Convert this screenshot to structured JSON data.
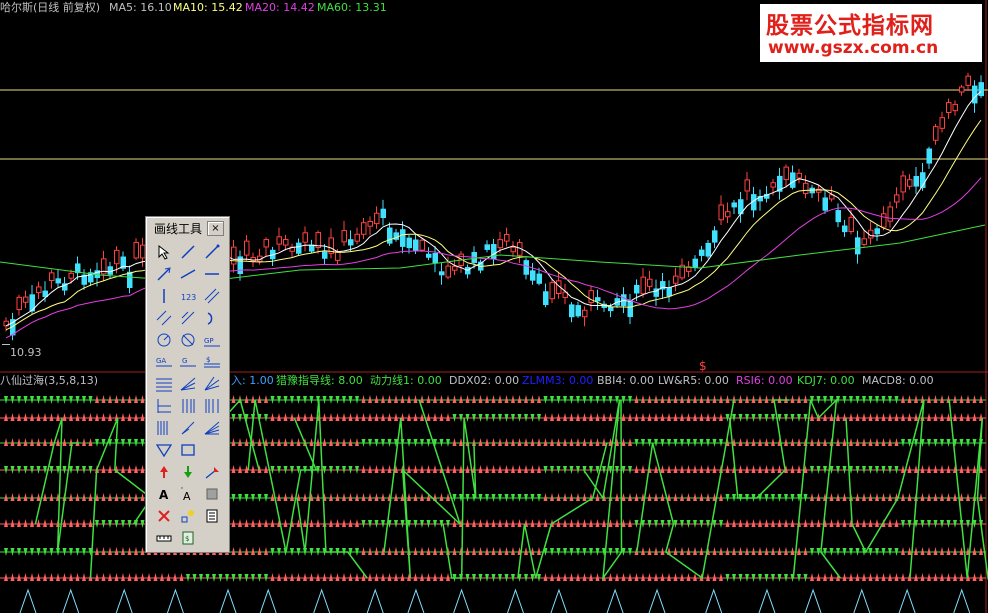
{
  "header": {
    "title": "哈尔斯(日线 前复权)",
    "ma5": "MA5: 16.10",
    "ma10": "MA10: 15.42",
    "ma20": "MA20: 14.42",
    "ma60": "MA60: 13.31"
  },
  "watermark": {
    "line1": "股票公式指标网",
    "line2": "www.gszx.com.cn"
  },
  "price_axis": {
    "low_label": "10.93"
  },
  "indicator": {
    "name": "八仙过海(3,5,8,13)",
    "items": [
      {
        "key": "i1",
        "text": "入: 1.00",
        "color": "#40a0ff"
      },
      {
        "key": "i2",
        "text": "猎豫指导线: 8.00",
        "color": "#40e040"
      },
      {
        "key": "i3",
        "text": "动力线1: 0.00",
        "color": "#40e040"
      },
      {
        "key": "i4",
        "text": "DDX02: 0.00",
        "color": "#c0c0c0"
      },
      {
        "key": "i5",
        "text": "ZLMM3: 0.00",
        "color": "#2020ff"
      },
      {
        "key": "i6",
        "text": "BBI4: 0.00",
        "color": "#c0c0c0"
      },
      {
        "key": "i7",
        "text": "LW&R5: 0.00",
        "color": "#c0c0c0"
      },
      {
        "key": "i8",
        "text": "RSI6: 0.00",
        "color": "#e040e0"
      },
      {
        "key": "i9",
        "text": "KDJ7: 0.00",
        "color": "#40e040"
      },
      {
        "key": "i10",
        "text": "MACD8: 0.00",
        "color": "#c0c0c0"
      }
    ]
  },
  "marker": "$",
  "toolbox": {
    "title": "画线工具",
    "close": "×",
    "tools": [
      "pointer-icon",
      "line-segment-icon",
      "ray-icon",
      "arrow-line-icon",
      "extended-line-icon",
      "horizontal-line-icon",
      "vertical-line-icon",
      "ruler-123-icon",
      "parallel-lines-icon",
      "channel-icon",
      "trend-channel-icon",
      "arc-icon",
      "circle-icon",
      "cycle-icon",
      "gann-point-icon",
      "gann-angle-icon",
      "gann-box-icon",
      "speed-lines-icon",
      "fibonacci-icon",
      "fan-icon",
      "fan-lines-icon",
      "period-lines-icon",
      "golden-lines-icon",
      "resistance-icon",
      "regression-icon",
      "percent-lines-icon",
      "fan-rays-icon",
      "triangle-icon",
      "rectangle-icon",
      "blank-icon",
      "up-arrow-icon",
      "down-arrow-icon",
      "price-marker-icon",
      "text-icon",
      "text-annotation-icon",
      "hide-icon",
      "delete-icon",
      "sun-moon-icon",
      "notes-icon",
      "measure-icon",
      "save-icon",
      "blank2-icon"
    ]
  },
  "colors": {
    "up": "#ff4040",
    "down": "#40e0ff",
    "ma5": "#ffffff",
    "ma10": "#ffff80",
    "ma20": "#e040e0",
    "ma60": "#40e040",
    "hline": "#e8e080",
    "arrow_up": "#ff6060",
    "arrow_down": "#40e040"
  }
}
